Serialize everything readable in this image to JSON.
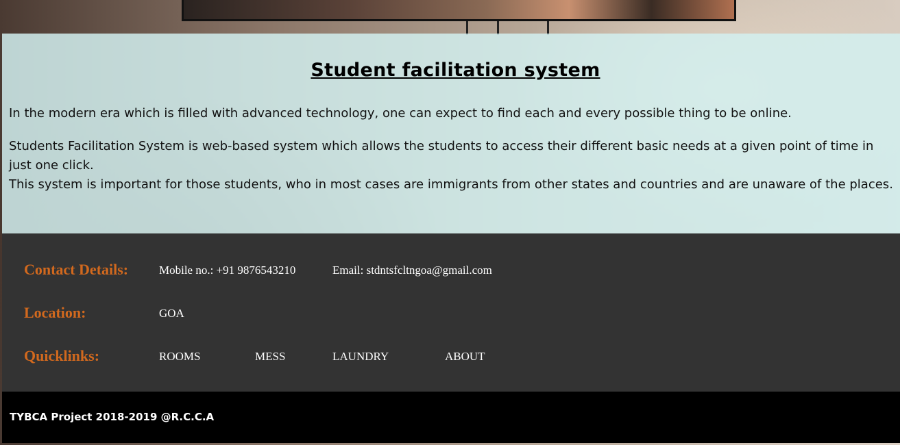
{
  "intro": {
    "title": "Student facilitation system",
    "para1": "In the modern era which is filled with advanced technology, one can expect to find each and every possible thing to be online.",
    "para2_line1": "Students Facilitation System is web-based system which allows the students to access their different basic needs at a given point of time in just one click.",
    "para2_line2": "This system is important for those students, who in most cases are immigrants from other states and countries and are unaware of the places."
  },
  "footer": {
    "contact_label": "Contact Details:",
    "mobile": "Mobile no.: +91 9876543210",
    "email": "Email: stdntsfcltngoa@gmail.com",
    "location_label": "Location:",
    "location_value": "GOA",
    "quicklinks_label": "Quicklinks:",
    "links": [
      "ROOMS",
      "MESS",
      "LAUNDRY",
      "ABOUT"
    ],
    "label_color": "#d2691e",
    "background_color": "#333333"
  },
  "copyright": "TYBCA Project 2018-2019 @R.C.C.A"
}
